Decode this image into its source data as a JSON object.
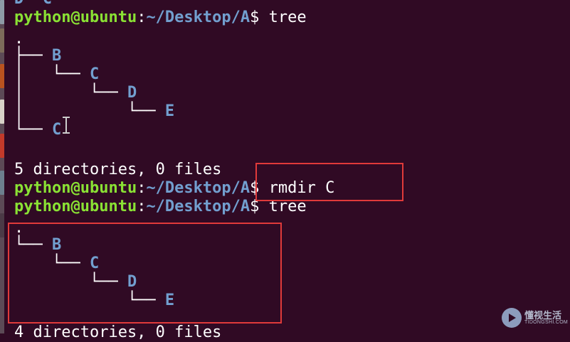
{
  "terminal": {
    "prompt_user": "python@ubuntu",
    "prompt_sep": ":",
    "prompt_path": "~/Desktop/A",
    "prompt_dollar": "$ ",
    "top_partial": "D  C",
    "cmd1": "tree",
    "tree1": {
      "root": ".",
      "b": "B",
      "c": "C",
      "d": "D",
      "e": "E",
      "c2": "C"
    },
    "summary1": "5 directories, 0 files",
    "cmd2": "rmdir C",
    "cmd3": "tree",
    "tree2": {
      "root": ".",
      "b": "B",
      "c": "C",
      "d": "D",
      "e": "E"
    },
    "summary2_partial": "4 directories, 0 files"
  },
  "watermark": {
    "text": "懂视生活",
    "sub": "TIDONGSHI.COM"
  },
  "colors": {
    "background": "#300a24",
    "prompt_green": "#8ae234",
    "dir_blue": "#729fcf",
    "highlight_red": "#e03a3a"
  }
}
